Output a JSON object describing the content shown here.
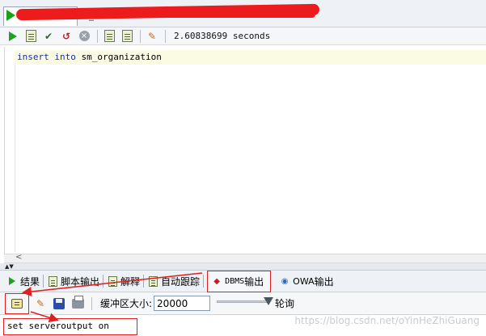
{
  "window": {
    "tab_title_hidden": "■■■■■■■■■■■■■■■■■■■■■■■■■■■■■"
  },
  "toolbar": {
    "elapsed": "2.60838699 seconds"
  },
  "editor": {
    "line1": {
      "kw1": "insert",
      "kw2": "into",
      "rest": "sm_organization"
    }
  },
  "output_tabs": [
    {
      "label": "结果",
      "icon": "play-icon"
    },
    {
      "label": "脚本输出",
      "icon": "script-icon"
    },
    {
      "label": "解释",
      "icon": "explain-icon"
    },
    {
      "label": "自动跟踪",
      "icon": "autotrace-icon"
    },
    {
      "label_prefix": "DBMS",
      "label": " 输出",
      "icon": "dbms-icon"
    },
    {
      "label_prefix": "OWA",
      "label": " 输出",
      "icon": "owa-icon"
    }
  ],
  "dbms_toolbar": {
    "buffer_label": "缓冲区大小:",
    "buffer_value": "20000",
    "poll_label": "轮询"
  },
  "output": {
    "text": "set serveroutput on"
  },
  "watermark": "https://blog.csdn.net/oYinHeZhiGuang",
  "colors": {
    "annotation_red": "#e02020",
    "keyword_blue": "#1c2f9c",
    "current_line": "#fbfbe3"
  }
}
